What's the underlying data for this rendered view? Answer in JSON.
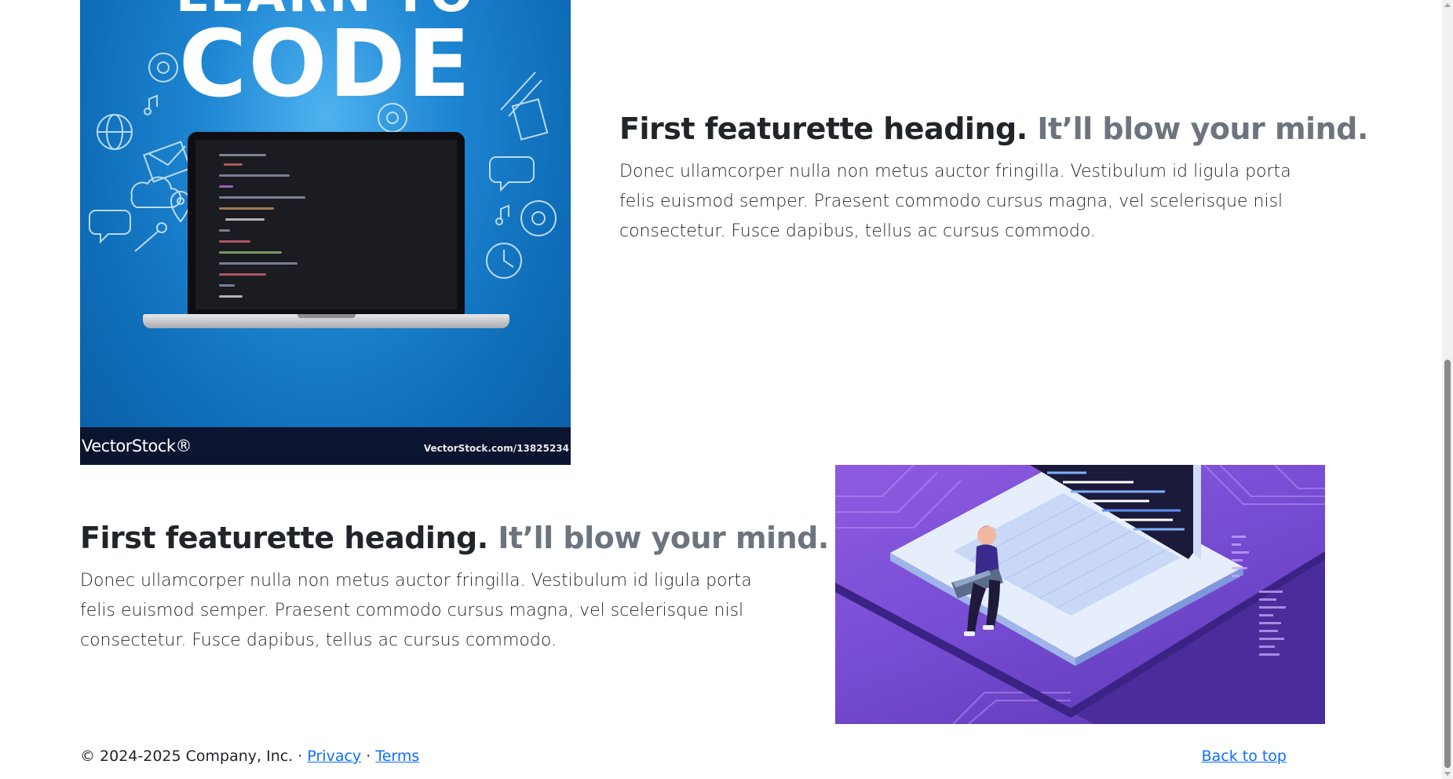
{
  "featurettes": [
    {
      "heading": "First featurette heading.",
      "heading_muted": "It’ll blow your mind.",
      "lead": "Donec ullamcorper nulla non metus auctor fringilla. Vestibulum id ligula porta felis euismod semper. Praesent commodo cursus magna, vel scelerisque nisl consectetur. Fusce dapibus, tellus ac cursus commodo.",
      "image": {
        "top_text": "LEARN TO",
        "main_text": "CODE",
        "watermark_logo": "VectorStock®",
        "watermark_url": "VectorStock.com/13825234"
      }
    },
    {
      "heading": "First featurette heading.",
      "heading_muted": "It’ll blow your mind.",
      "lead": "Donec ullamcorper nulla non metus auctor fringilla. Vestibulum id ligula porta felis euismod semper. Praesent commodo cursus magna, vel scelerisque nisl consectetur. Fusce dapibus, tellus ac cursus commodo."
    }
  ],
  "footer": {
    "copyright": "© 2024-2025 Company, Inc. ·",
    "privacy": "Privacy",
    "separator": "·",
    "terms": "Terms",
    "back_to_top": "Back to top"
  },
  "colors": {
    "link": "#0d6efd",
    "muted": "#6c757d",
    "text": "#212529"
  }
}
